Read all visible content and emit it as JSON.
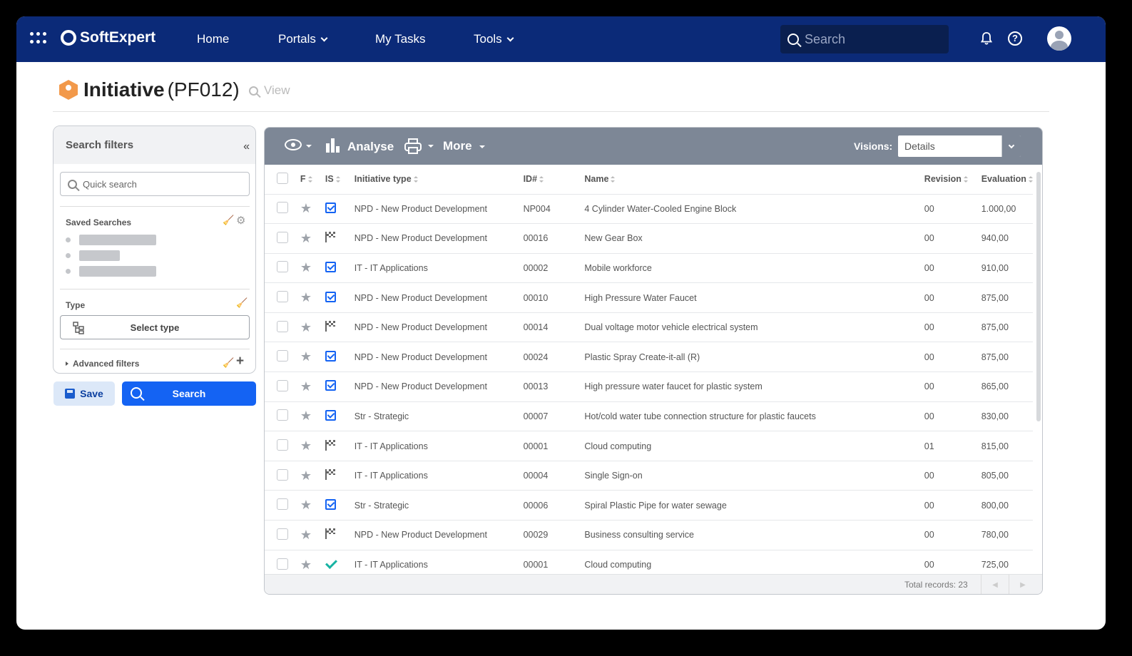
{
  "topbar": {
    "brand": "SoftExpert",
    "nav": [
      {
        "label": "Home"
      },
      {
        "label": "Portals"
      },
      {
        "label": "My Tasks"
      },
      {
        "label": "Tools"
      }
    ],
    "search_placeholder": "Search",
    "help_glyph": "?",
    "colors": {
      "bar": "#0b2a78",
      "search_bg": "#0a1f4f"
    }
  },
  "page": {
    "title": "Initiative",
    "code": "(PF012)",
    "view_label": "View"
  },
  "filters": {
    "header": "Search filters",
    "collapse_glyph": "«",
    "quick_search_placeholder": "Quick search",
    "saved_searches_label": "Saved Searches",
    "type_label": "Type",
    "select_type_label": "Select type",
    "advanced_label": "Advanced filters",
    "save_label": "Save",
    "search_label": "Search"
  },
  "toolbar": {
    "analyse_label": "Analyse",
    "more_label": "More",
    "visions_label": "Visions:",
    "visions_value": "Details"
  },
  "table": {
    "columns": {
      "f": "F",
      "is": "IS",
      "type": "Initiative type",
      "id": "ID#",
      "name": "Name",
      "revision": "Revision",
      "evaluation": "Evaluation"
    },
    "rows": [
      {
        "status": "check",
        "type": "NPD - New Product Development",
        "id": "NP004",
        "name": "4 Cylinder Water-Cooled Engine Block",
        "revision": "00",
        "evaluation": "1.000,00"
      },
      {
        "status": "flag",
        "type": "NPD - New Product Development",
        "id": "00016",
        "name": "New Gear Box",
        "revision": "00",
        "evaluation": "940,00"
      },
      {
        "status": "check",
        "type": "IT - IT Applications",
        "id": "00002",
        "name": "Mobile workforce",
        "revision": "00",
        "evaluation": "910,00"
      },
      {
        "status": "check",
        "type": "NPD - New Product Development",
        "id": "00010",
        "name": "High Pressure Water Faucet",
        "revision": "00",
        "evaluation": "875,00"
      },
      {
        "status": "flag",
        "type": "NPD - New Product Development",
        "id": "00014",
        "name": "Dual voltage motor vehicle electrical system",
        "revision": "00",
        "evaluation": "875,00"
      },
      {
        "status": "check",
        "type": "NPD - New Product Development",
        "id": "00024",
        "name": "Plastic Spray Create-it-all (R)",
        "revision": "00",
        "evaluation": "875,00"
      },
      {
        "status": "check",
        "type": "NPD - New Product Development",
        "id": "00013",
        "name": "High pressure water faucet for plastic system",
        "revision": "00",
        "evaluation": "865,00"
      },
      {
        "status": "check",
        "type": "Str - Strategic",
        "id": "00007",
        "name": "Hot/cold water tube connection structure for plastic faucets",
        "revision": "00",
        "evaluation": "830,00"
      },
      {
        "status": "flag",
        "type": "IT - IT Applications",
        "id": "00001",
        "name": "Cloud computing",
        "revision": "01",
        "evaluation": "815,00"
      },
      {
        "status": "flag",
        "type": "IT - IT Applications",
        "id": "00004",
        "name": "Single Sign-on",
        "revision": "00",
        "evaluation": "805,00"
      },
      {
        "status": "check",
        "type": "Str - Strategic",
        "id": "00006",
        "name": "Spiral Plastic Pipe for water sewage",
        "revision": "00",
        "evaluation": "800,00"
      },
      {
        "status": "flag",
        "type": "NPD - New Product Development",
        "id": "00029",
        "name": "Business consulting service",
        "revision": "00",
        "evaluation": "780,00"
      },
      {
        "status": "done",
        "type": "IT - IT Applications",
        "id": "00001",
        "name": "Cloud computing",
        "revision": "00",
        "evaluation": "725,00"
      }
    ],
    "total_records": "Total records: 23",
    "prev_glyph": "◀",
    "next_glyph": "▶"
  },
  "icons": {
    "status_check": "checkbox-check-icon",
    "status_flag": "checkered-flag-icon",
    "status_done": "green-check-icon",
    "favorite": "star-icon"
  },
  "glyphs": {
    "star": "★",
    "gear": "⚙",
    "broom": "🧹",
    "plus": "+"
  }
}
